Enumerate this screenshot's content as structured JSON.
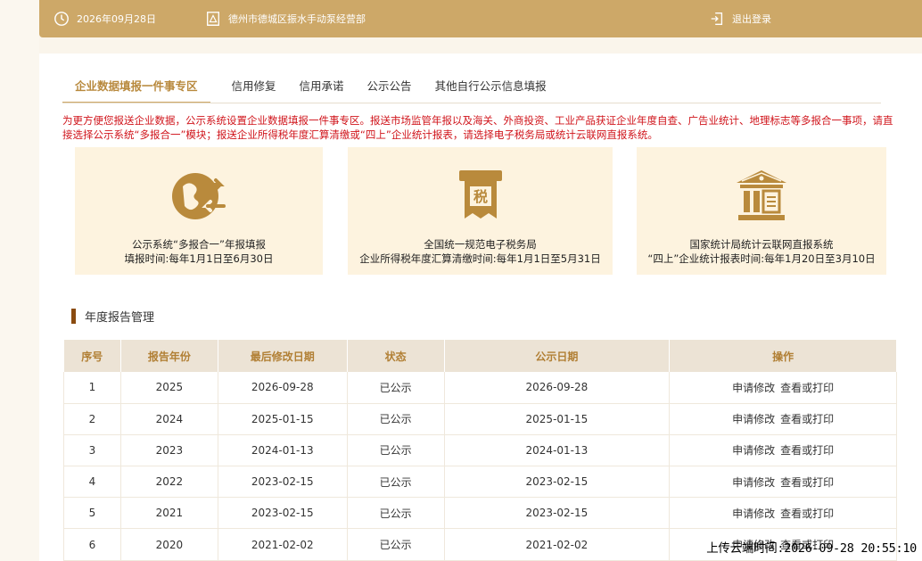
{
  "header": {
    "date": "2026年09月28日",
    "shop_name": "德州市德城区振水手动泵经营部",
    "logout_label": "退出登录",
    "icons": {
      "date": "clock-icon",
      "shop": "shop-icon",
      "logout": "logout-icon"
    }
  },
  "tabs": [
    {
      "label": "企业数据填报一件事专区",
      "active": true
    },
    {
      "label": "信用修复",
      "active": false
    },
    {
      "label": "信用承诺",
      "active": false
    },
    {
      "label": "公示公告",
      "active": false
    },
    {
      "label": "其他自行公示信息填报",
      "active": false
    }
  ],
  "notice": "为更方便您报送企业数据，公示系统设置企业数据填报一件事专区。报送市场监管年报以及海关、外商投资、工业产品获证企业年度自查、广告业统计、地理标志等多报合一事项，请直接选择公示系统“多报合一”模块；报送企业所得税年度汇算清缴或“四上”企业统计报表，请选择电子税务局或统计云联网直报系统。",
  "tiles": [
    {
      "icon": "multi-report-icon",
      "line1": "公示系统“多报合一”年报填报",
      "line2": "填报时间:每年1月1日至6月30日"
    },
    {
      "icon": "tax-icon",
      "line1": "全国统一规范电子税务局",
      "line2": "企业所得税年度汇算清缴时间:每年1月1日至5月31日"
    },
    {
      "icon": "statistics-bureau-icon",
      "line1": "国家统计局统计云联网直报系统",
      "line2": "“四上”企业统计报表时间:每年1月20日至3月10日"
    }
  ],
  "section_title": "年度报告管理",
  "table": {
    "columns": [
      "序号",
      "报告年份",
      "最后修改日期",
      "状态",
      "公示日期",
      "操作"
    ],
    "actions": [
      "申请修改",
      "查看或打印"
    ],
    "rows": [
      {
        "no": "1",
        "year": "2025",
        "modified": "2026-09-28",
        "status": "已公示",
        "published": "2026-09-28"
      },
      {
        "no": "2",
        "year": "2024",
        "modified": "2025-01-15",
        "status": "已公示",
        "published": "2025-01-15"
      },
      {
        "no": "3",
        "year": "2023",
        "modified": "2024-01-13",
        "status": "已公示",
        "published": "2024-01-13"
      },
      {
        "no": "4",
        "year": "2022",
        "modified": "2023-02-15",
        "status": "已公示",
        "published": "2023-02-15"
      },
      {
        "no": "5",
        "year": "2021",
        "modified": "2023-02-15",
        "status": "已公示",
        "published": "2023-02-15"
      },
      {
        "no": "6",
        "year": "2020",
        "modified": "2021-02-02",
        "status": "已公示",
        "published": "2021-02-02"
      }
    ]
  },
  "upload_stamp": "上传云端时间:2026-09-28 20:55:10",
  "colors": {
    "accent": "#cda868",
    "notice": "#d0141b",
    "tile_bg": "#fdf3df",
    "icon": "#b98a3c"
  }
}
